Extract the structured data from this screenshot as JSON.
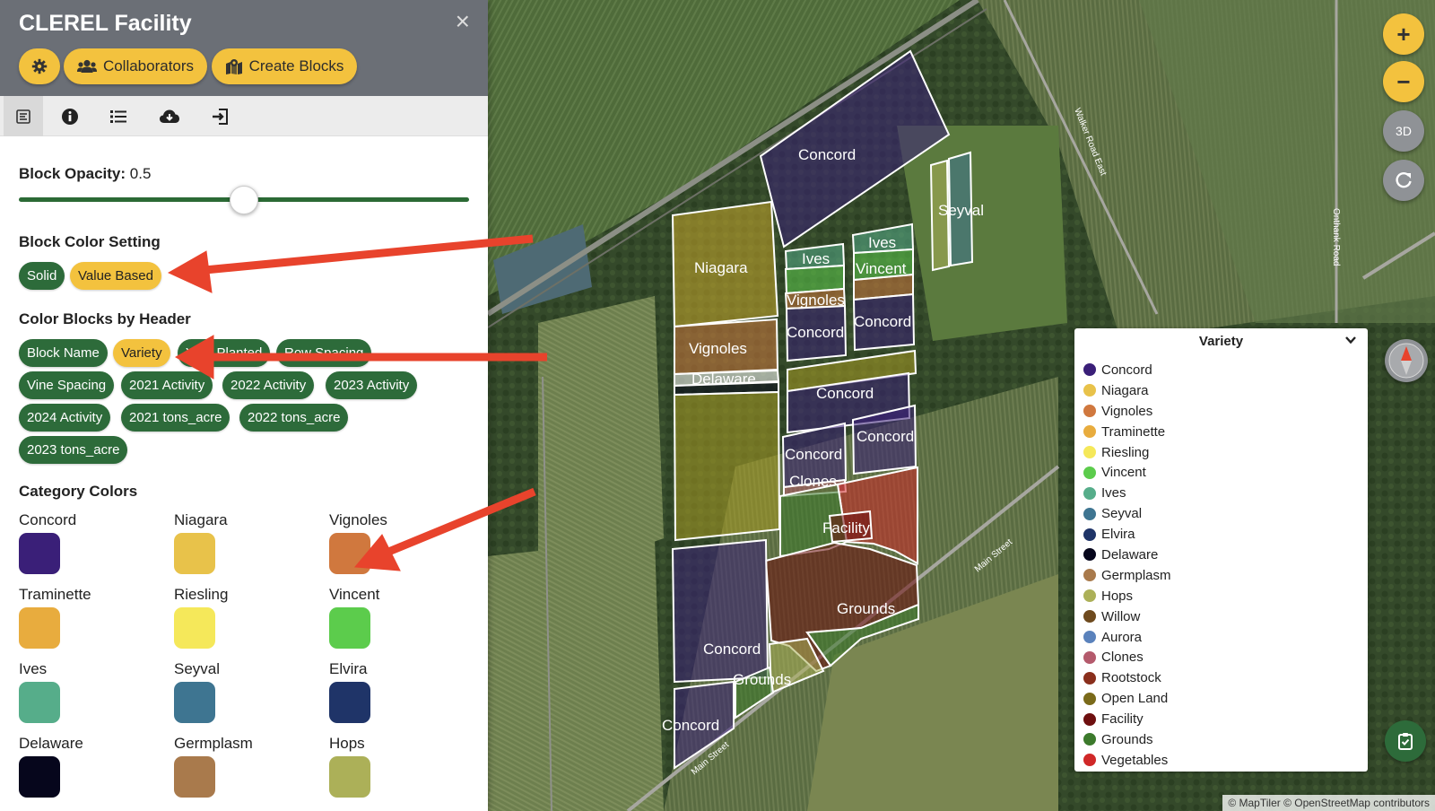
{
  "panel": {
    "title": "CLEREL Facility",
    "close": "×",
    "collaborators_label": "Collaborators",
    "create_blocks_label": "Create Blocks",
    "block_opacity_label": "Block Opacity:",
    "block_opacity_value": "0.5",
    "block_opacity": 0.5,
    "block_color_setting_label": "Block Color Setting",
    "color_setting_options": [
      "Solid",
      "Value Based"
    ],
    "color_setting_selected": "Value Based",
    "color_blocks_by_header_label": "Color Blocks by Header",
    "header_options": [
      "Block Name",
      "Variety",
      "Year Planted",
      "Row Spacing",
      "Vine Spacing",
      "2021 Activity",
      "2022 Activity",
      "2023 Activity",
      "2024 Activity",
      "2021 tons_acre",
      "2022 tons_acre",
      "2023 tons_acre"
    ],
    "header_selected": "Variety",
    "category_colors_label": "Category Colors",
    "categories": [
      {
        "name": "Concord",
        "color": "#3a1f78"
      },
      {
        "name": "Niagara",
        "color": "#e8c24a"
      },
      {
        "name": "Vignoles",
        "color": "#d0783e"
      },
      {
        "name": "Traminette",
        "color": "#e8ac3e"
      },
      {
        "name": "Riesling",
        "color": "#f5e85a"
      },
      {
        "name": "Vincent",
        "color": "#5ccc4c"
      },
      {
        "name": "Ives",
        "color": "#56ad8a"
      },
      {
        "name": "Seyval",
        "color": "#3e7591"
      },
      {
        "name": "Elvira",
        "color": "#1f3468"
      },
      {
        "name": "Delaware",
        "color": "#06061c"
      },
      {
        "name": "Germplasm",
        "color": "#a97a4c"
      },
      {
        "name": "Hops",
        "color": "#acb058"
      }
    ]
  },
  "tabs": [
    "layers-icon",
    "info-icon",
    "list-icon",
    "cloud-download-icon",
    "import-icon"
  ],
  "map": {
    "zoom_in": "+",
    "zoom_out": "−",
    "three_d": "3D",
    "block_labels": [
      "Concord",
      "Seyval",
      "Niagara",
      "Ives",
      "Ives",
      "Vincent",
      "Vignoles",
      "Concord",
      "Concord",
      "Vignoles",
      "Delaware",
      "Concord",
      "Concord",
      "Concord",
      "Clones",
      "Facility",
      "Grounds",
      "Concord",
      "Grounds",
      "Concord"
    ],
    "road_labels": [
      "Walker Road East",
      "Onthank Road",
      "Main Street",
      "Main Street"
    ],
    "attribution": "© MapTiler © OpenStreetMap contributors"
  },
  "legend": {
    "title": "Variety",
    "items": [
      {
        "label": "Concord",
        "color": "#3a1f78"
      },
      {
        "label": "Niagara",
        "color": "#e8c24a"
      },
      {
        "label": "Vignoles",
        "color": "#d0783e"
      },
      {
        "label": "Traminette",
        "color": "#e8ac3e"
      },
      {
        "label": "Riesling",
        "color": "#f5e85a"
      },
      {
        "label": "Vincent",
        "color": "#5ccc4c"
      },
      {
        "label": "Ives",
        "color": "#56ad8a"
      },
      {
        "label": "Seyval",
        "color": "#3e7591"
      },
      {
        "label": "Elvira",
        "color": "#1f3468"
      },
      {
        "label": "Delaware",
        "color": "#06061c"
      },
      {
        "label": "Germplasm",
        "color": "#a97a4c"
      },
      {
        "label": "Hops",
        "color": "#acb058"
      },
      {
        "label": "Willow",
        "color": "#6e4a1e"
      },
      {
        "label": "Aurora",
        "color": "#5a82bc"
      },
      {
        "label": "Clones",
        "color": "#b45a6c"
      },
      {
        "label": "Rootstock",
        "color": "#8a2f1c"
      },
      {
        "label": "Open Land",
        "color": "#7a6a1a"
      },
      {
        "label": "Facility",
        "color": "#6e0f0f"
      },
      {
        "label": "Grounds",
        "color": "#3c7a2c"
      },
      {
        "label": "Vegetables",
        "color": "#d02828"
      }
    ]
  },
  "colors": {
    "accent": "#f3c23e",
    "primary": "#2d6b3a",
    "header_bg": "#6b6f76",
    "arrow": "#e8432c"
  }
}
